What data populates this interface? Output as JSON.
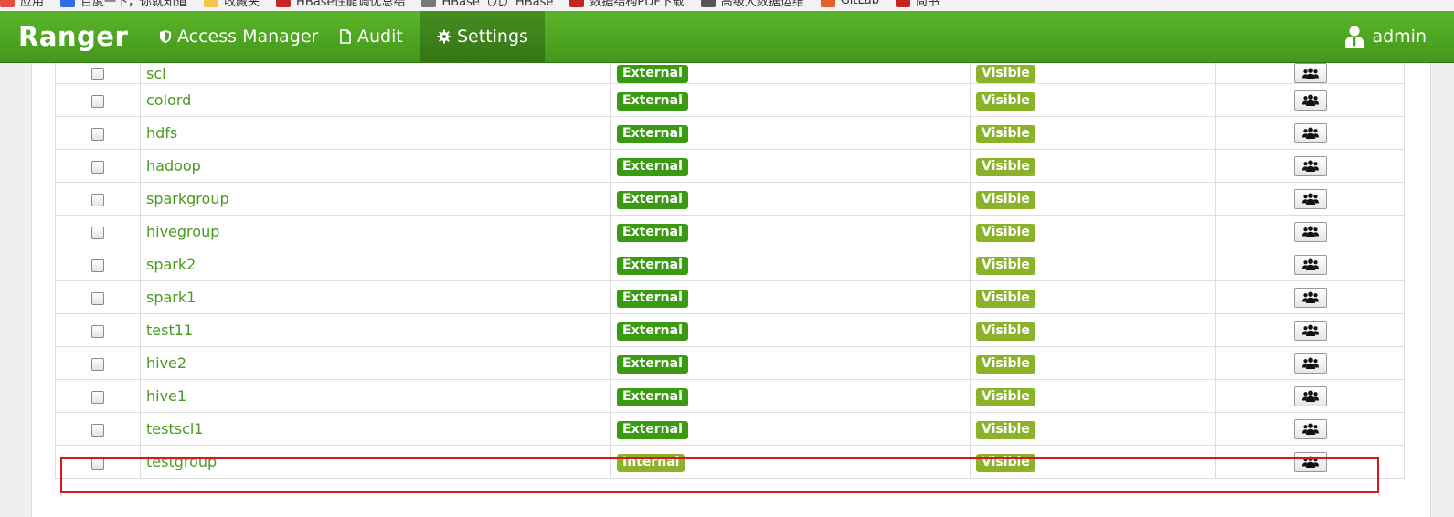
{
  "bookmarks": [
    {
      "label": "应用",
      "icon": "apps-icon",
      "color": "#e84c3d"
    },
    {
      "label": "百度一下，你就知道",
      "icon": "baidu-icon",
      "color": "#2b6de5"
    },
    {
      "label": "收藏夹",
      "icon": "folder-icon",
      "color": "#f2c64c"
    },
    {
      "label": "HBase性能调优总结",
      "icon": "csdn-icon",
      "color": "#c4271f"
    },
    {
      "label": "HBase（九）HBase",
      "icon": "page-icon",
      "color": "#777777"
    },
    {
      "label": "数据结构PDF下载",
      "icon": "csdn-icon",
      "color": "#c4271f"
    },
    {
      "label": "高级大数据运维",
      "icon": "folder-icon",
      "color": "#555555"
    },
    {
      "label": "GitLab",
      "icon": "gitlab-icon",
      "color": "#e2622a"
    },
    {
      "label": "简书",
      "icon": "jianshu-icon",
      "color": "#c4271f"
    }
  ],
  "navbar": {
    "brand": "Ranger",
    "items": [
      {
        "label": "Access Manager",
        "icon": "shield-icon"
      },
      {
        "label": "Audit",
        "icon": "file-icon"
      },
      {
        "label": "Settings",
        "icon": "gear-icon",
        "active": true
      }
    ],
    "user": "admin"
  },
  "colors": {
    "navbar": "#4fa823",
    "external_label": "#3a9a12",
    "internal_label": "#8bb32a",
    "visible_label": "#8bb32a",
    "group_link": "#4a9a1e",
    "highlight_box": "#e0141a"
  },
  "groups": [
    {
      "name": "scl",
      "source": "External",
      "visibility": "Visible"
    },
    {
      "name": "colord",
      "source": "External",
      "visibility": "Visible"
    },
    {
      "name": "hdfs",
      "source": "External",
      "visibility": "Visible"
    },
    {
      "name": "hadoop",
      "source": "External",
      "visibility": "Visible"
    },
    {
      "name": "sparkgroup",
      "source": "External",
      "visibility": "Visible"
    },
    {
      "name": "hivegroup",
      "source": "External",
      "visibility": "Visible"
    },
    {
      "name": "spark2",
      "source": "External",
      "visibility": "Visible"
    },
    {
      "name": "spark1",
      "source": "External",
      "visibility": "Visible"
    },
    {
      "name": "test11",
      "source": "External",
      "visibility": "Visible"
    },
    {
      "name": "hive2",
      "source": "External",
      "visibility": "Visible"
    },
    {
      "name": "hive1",
      "source": "External",
      "visibility": "Visible"
    },
    {
      "name": "testscl1",
      "source": "External",
      "visibility": "Visible"
    },
    {
      "name": "testgroup",
      "source": "Internal",
      "visibility": "Visible"
    }
  ]
}
